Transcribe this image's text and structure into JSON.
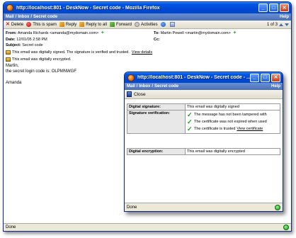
{
  "main_window": {
    "title": "http://localhost:801 - DeskNow - Secret code - Mozilla Firefox",
    "breadcrumb": {
      "mail": "Mail",
      "inbox": "Inbox",
      "current": "Secret code",
      "help": "Help"
    },
    "toolbar": {
      "delete": "Delete",
      "spam": "This is spam",
      "reply": "Reply",
      "reply_all": "Reply to all",
      "forward": "Forward",
      "activities": "Activities",
      "pager": "1 of 3"
    },
    "headers": {
      "from_label": "From:",
      "from_value": "Amanda Richards <amanda@mydomain.com>",
      "to_label": "To:",
      "to_value": "Martin Powell <martin@mydomain.com>",
      "date_label": "Date:",
      "date_value": "12/01/05 2:58 PM",
      "cc_label": "Cc:",
      "cc_value": "",
      "subject_label": "Subject:",
      "subject_value": "Secret code"
    },
    "signature_notice": "This email was digitally signed. The signature is verified and trusted.",
    "view_details": "View details",
    "encryption_notice": "This email was digitally encrypted.",
    "body_lines": [
      "Martin,",
      "the secret login code is: OLPMNWGF",
      "",
      "Amanda"
    ],
    "status": "Done"
  },
  "popup": {
    "title": "http://localhost:801 - DeskNow - Secret code - ...",
    "breadcrumb": {
      "mail": "Mail",
      "inbox": "Inbox",
      "current": "Secret code",
      "help": "Help"
    },
    "close_label": "Close",
    "rows": {
      "digital_signature_label": "Digital signature:",
      "digital_signature_value": "This email was digitally signed",
      "verification_label": "Signature verification:",
      "checks": [
        "The message has not been tampered with",
        "The certificate was not expired when used",
        "The certificate is trusted"
      ],
      "view_certificate": "View certificate",
      "encryption_label": "Digital encryption:",
      "encryption_value": "This email was digitally encrypted"
    },
    "status": "Done"
  },
  "colors": {
    "titlebar": "#0058e6",
    "breadcrumb_bar": "#5a7fc4",
    "window_bg": "#ece9d8",
    "check_green": "#1ba21b",
    "delete_red": "#c81e1e"
  }
}
